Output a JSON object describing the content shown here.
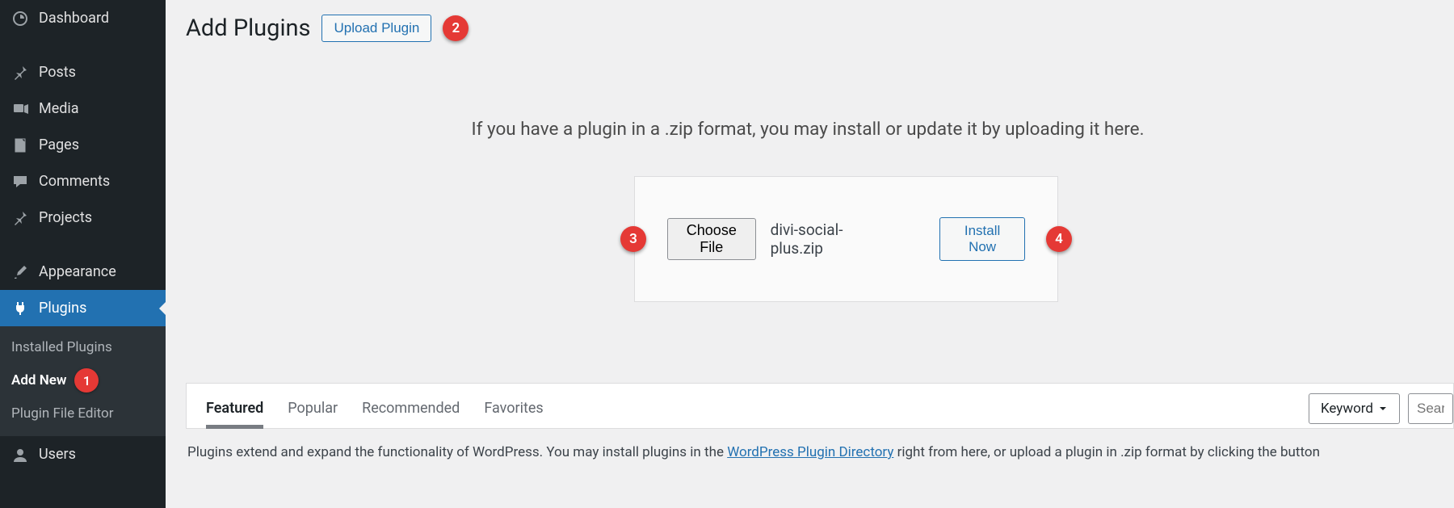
{
  "sidebar": {
    "items": [
      {
        "label": "Dashboard"
      },
      {
        "label": "Posts"
      },
      {
        "label": "Media"
      },
      {
        "label": "Pages"
      },
      {
        "label": "Comments"
      },
      {
        "label": "Projects"
      },
      {
        "label": "Appearance"
      },
      {
        "label": "Plugins"
      },
      {
        "label": "Users"
      }
    ],
    "submenu": [
      {
        "label": "Installed Plugins"
      },
      {
        "label": "Add New"
      },
      {
        "label": "Plugin File Editor"
      }
    ]
  },
  "markers": {
    "1": "1",
    "2": "2",
    "3": "3",
    "4": "4"
  },
  "header": {
    "title": "Add Plugins",
    "upload_btn": "Upload Plugin"
  },
  "upload": {
    "desc": "If you have a plugin in a .zip format, you may install or update it by uploading it here.",
    "choose_file": "Choose File",
    "file_name": "divi-social-plus.zip",
    "install_now": "Install Now"
  },
  "tabs": [
    "Featured",
    "Popular",
    "Recommended",
    "Favorites"
  ],
  "search": {
    "keyword": "Keyword",
    "placeholder": "Search"
  },
  "footer": {
    "pre": "Plugins extend and expand the functionality of WordPress. You may install plugins in the ",
    "link": "WordPress Plugin Directory",
    "post": " right from here, or upload a plugin in .zip format by clicking the button"
  }
}
